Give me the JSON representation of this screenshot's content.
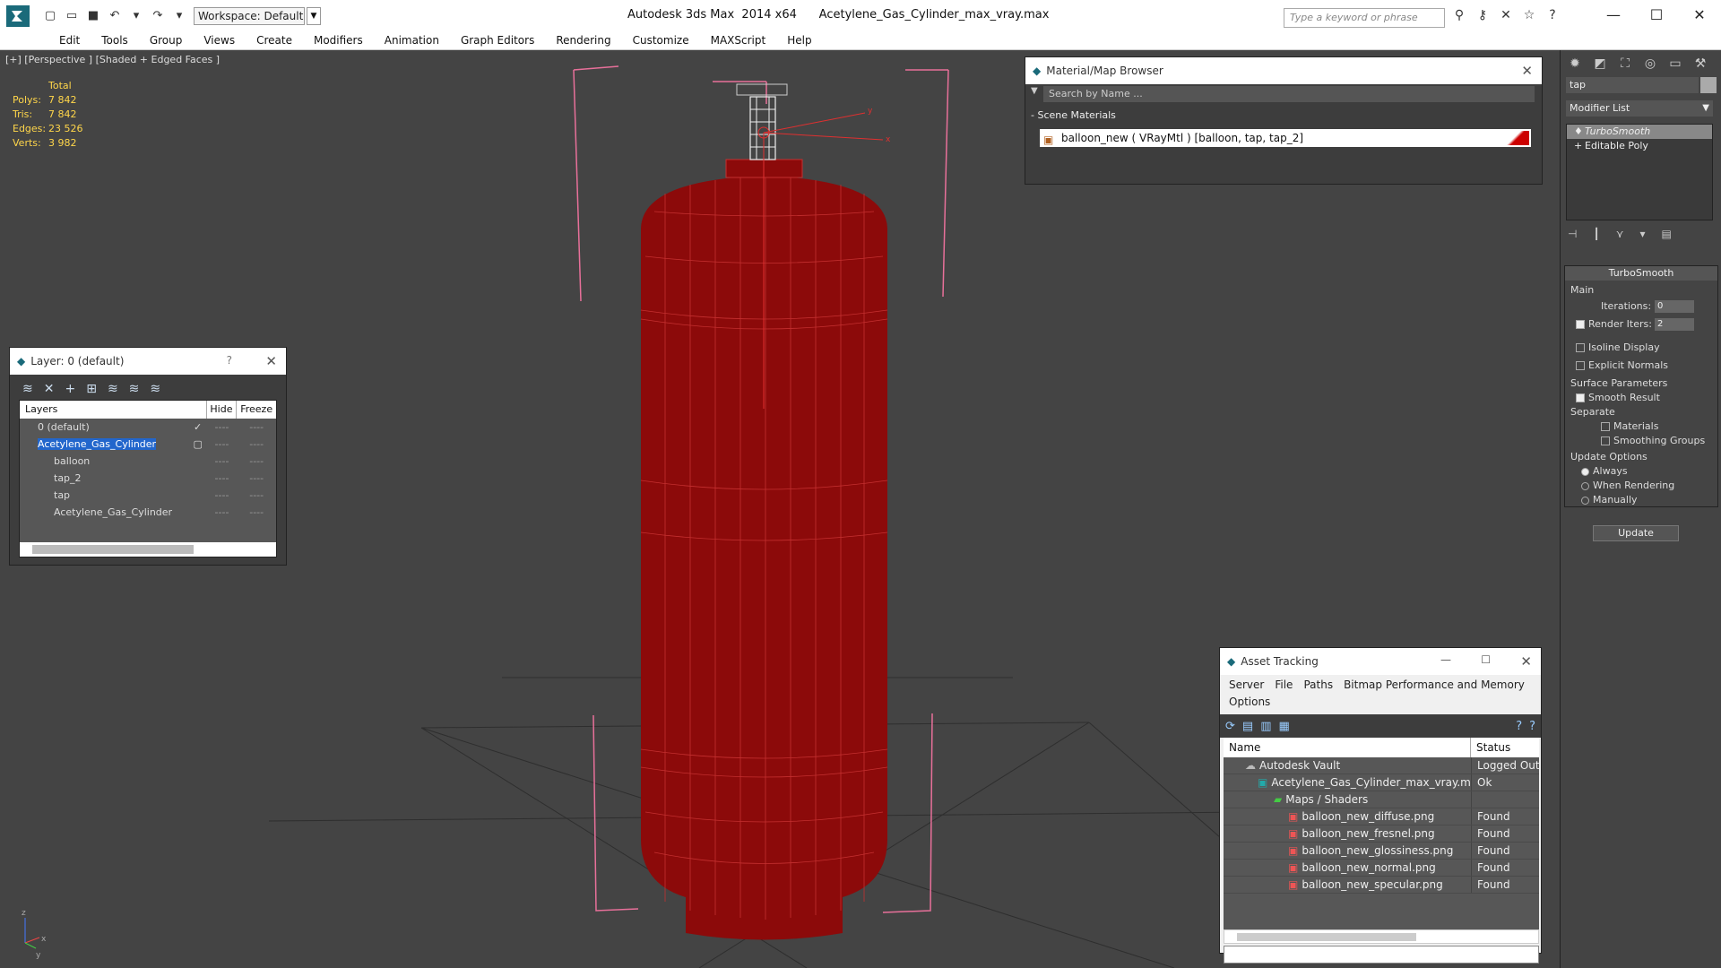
{
  "app": {
    "title": "Autodesk 3ds Max  2014 x64      Acetylene_Gas_Cylinder_max_vray.max",
    "workspace": "Workspace: Default",
    "search_placeholder": "Type a keyword or phrase"
  },
  "menu": [
    "Edit",
    "Tools",
    "Group",
    "Views",
    "Create",
    "Modifiers",
    "Animation",
    "Graph Editors",
    "Rendering",
    "Customize",
    "MAXScript",
    "Help"
  ],
  "viewport": {
    "label": "[+] [Perspective ] [Shaded + Edged Faces ]",
    "stats_header": "Total",
    "stats": [
      {
        "k": "Polys:",
        "v": "7 842"
      },
      {
        "k": "Tris:",
        "v": "7 842"
      },
      {
        "k": "Edges:",
        "v": "23 526"
      },
      {
        "k": "Verts:",
        "v": "3 982"
      }
    ],
    "gizmo": {
      "y": "y",
      "x": "x"
    },
    "axis": {
      "z": "z",
      "x": "x",
      "y": "y"
    },
    "colors": {
      "cylinder": "#8c0a0a",
      "wire": "#c43030",
      "bbox": "#e8709a",
      "grid": "#2a2a2a"
    }
  },
  "layer_panel": {
    "title": "Layer: 0 (default)",
    "help": "?",
    "cols": {
      "name": "Layers",
      "hide": "Hide",
      "freeze": "Freeze"
    },
    "rows": [
      {
        "name": "0 (default)",
        "check": "✓",
        "hide": "----",
        "freeze": "----"
      },
      {
        "name": "Acetylene_Gas_Cylinder",
        "check": "▢",
        "hide": "----",
        "freeze": "----"
      },
      {
        "name": "balloon",
        "check": "",
        "hide": "----",
        "freeze": "----"
      },
      {
        "name": "tap_2",
        "check": "",
        "hide": "----",
        "freeze": "----"
      },
      {
        "name": "tap",
        "check": "",
        "hide": "----",
        "freeze": "----"
      },
      {
        "name": "Acetylene_Gas_Cylinder",
        "check": "",
        "hide": "----",
        "freeze": "----"
      }
    ]
  },
  "material_browser": {
    "title": "Material/Map Browser",
    "search": "Search by Name ...",
    "section": "- Scene Materials",
    "item": "balloon_new  ( VRayMtl )  [balloon, tap, tap_2]"
  },
  "asset_tracking": {
    "title": "Asset Tracking",
    "menu": [
      "Server",
      "File",
      "Paths",
      "Bitmap Performance and Memory",
      "Options"
    ],
    "cols": {
      "name": "Name",
      "status": "Status"
    },
    "rows": [
      {
        "name": "Autodesk Vault",
        "status": "Logged Out ..."
      },
      {
        "name": "Acetylene_Gas_Cylinder_max_vray.max",
        "status": "Ok"
      },
      {
        "name": "Maps / Shaders",
        "status": ""
      },
      {
        "name": "balloon_new_diffuse.png",
        "status": "Found"
      },
      {
        "name": "balloon_new_fresnel.png",
        "status": "Found"
      },
      {
        "name": "balloon_new_glossiness.png",
        "status": "Found"
      },
      {
        "name": "balloon_new_normal.png",
        "status": "Found"
      },
      {
        "name": "balloon_new_specular.png",
        "status": "Found"
      }
    ]
  },
  "command_panel": {
    "object_name": "tap",
    "modifier_list": "Modifier List",
    "stack": [
      "TurboSmooth",
      "Editable Poly"
    ],
    "rollout_title": "TurboSmooth",
    "main": "Main",
    "iterations_label": "Iterations:",
    "iterations": "0",
    "render_iters_label": "Render Iters:",
    "render_iters": "2",
    "isoline": "Isoline Display",
    "explicit": "Explicit Normals",
    "surface": "Surface Parameters",
    "smooth_result": "Smooth Result",
    "separate": "Separate",
    "materials": "Materials",
    "smoothing_groups": "Smoothing Groups",
    "update_options": "Update Options",
    "always": "Always",
    "when_rendering": "When Rendering",
    "manually": "Manually",
    "update_btn": "Update"
  }
}
